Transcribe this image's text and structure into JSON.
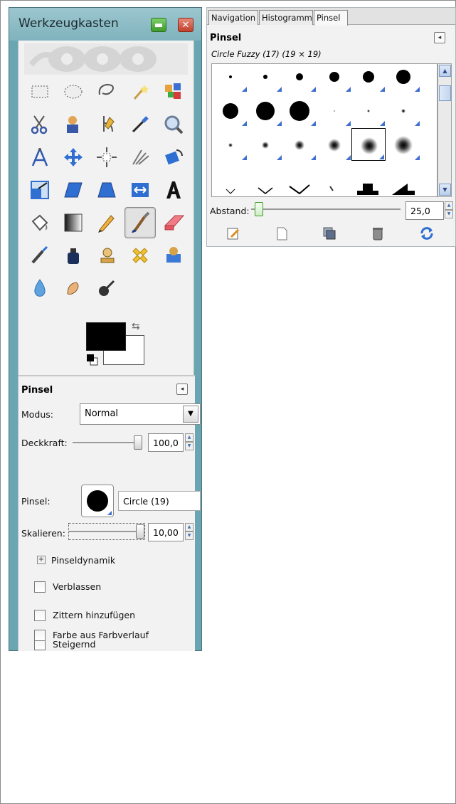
{
  "toolbox": {
    "title": "Werkzeugkasten",
    "title_min_glyph": "▬",
    "title_close_glyph": "✕",
    "tools": [
      {
        "name": "rect-select-icon"
      },
      {
        "name": "ellipse-select-icon"
      },
      {
        "name": "free-select-icon"
      },
      {
        "name": "fuzzy-select-icon"
      },
      {
        "name": "color-select-icon"
      },
      {
        "name": "scissors-select-icon"
      },
      {
        "name": "foreground-select-icon"
      },
      {
        "name": "paths-icon"
      },
      {
        "name": "color-picker-icon"
      },
      {
        "name": "zoom-icon"
      },
      {
        "name": "measure-icon"
      },
      {
        "name": "move-icon"
      },
      {
        "name": "align-icon"
      },
      {
        "name": "crop-icon"
      },
      {
        "name": "rotate-icon"
      },
      {
        "name": "scale-icon"
      },
      {
        "name": "shear-icon"
      },
      {
        "name": "perspective-icon"
      },
      {
        "name": "flip-icon"
      },
      {
        "name": "text-icon"
      },
      {
        "name": "bucket-fill-icon"
      },
      {
        "name": "blend-icon"
      },
      {
        "name": "pencil-icon"
      },
      {
        "name": "paintbrush-icon"
      },
      {
        "name": "eraser-icon"
      },
      {
        "name": "airbrush-icon"
      },
      {
        "name": "ink-icon"
      },
      {
        "name": "clone-icon"
      },
      {
        "name": "heal-icon"
      },
      {
        "name": "perspective-clone-icon"
      },
      {
        "name": "blur-icon"
      },
      {
        "name": "smudge-icon"
      },
      {
        "name": "dodge-burn-icon"
      }
    ],
    "active_tool": 23,
    "swap_glyph": "⇆"
  },
  "tool_options": {
    "title": "Pinsel",
    "collapse_glyph": "◂",
    "mode_label": "Modus:",
    "mode_value": "Normal",
    "mode_arrow": "▼",
    "opacity_label": "Deckkraft:",
    "opacity_value": "100,0",
    "opacity_fraction": 1.0,
    "brush_label": "Pinsel:",
    "brush_name": "Circle (19)",
    "scale_label": "Skalieren:",
    "scale_value": "10,00",
    "scale_fraction": 1.0,
    "dynamics_expander": "+",
    "dynamics_label": "Pinseldynamik",
    "checkboxes": [
      {
        "label": "Verblassen",
        "checked": false
      },
      {
        "label": "Zittern hinzufügen",
        "checked": false
      },
      {
        "label": "Steigernd",
        "checked": false
      },
      {
        "label": "Farbe aus Farbverlauf",
        "checked": false
      }
    ]
  },
  "dock": {
    "tabs": [
      "Navigation",
      "Histogramm",
      "Pinsel"
    ],
    "active_tab": 2,
    "title": "Pinsel",
    "collapse_glyph": "◂",
    "selected_brush": "Circle Fuzzy (17) (19 × 19)",
    "spacing_label": "Abstand:",
    "spacing_value": "25,0",
    "spacing_fraction": 0.25,
    "scroll_up": "▲",
    "scroll_down": "▼",
    "footer_buttons": [
      "edit-brush-icon",
      "new-brush-icon",
      "duplicate-brush-icon",
      "delete-brush-icon",
      "refresh-brushes-icon"
    ]
  }
}
